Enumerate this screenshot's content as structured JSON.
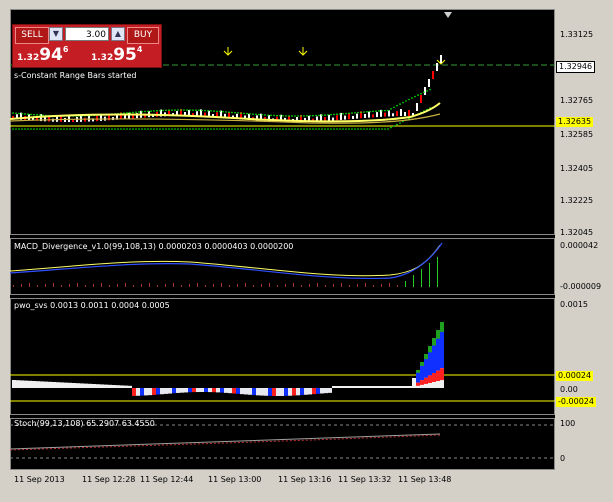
{
  "trade_panel": {
    "sell_label": "SELL",
    "buy_label": "BUY",
    "lot": "3.00",
    "bid": {
      "small": "1.32",
      "big": "94",
      "sup": "6"
    },
    "ask": {
      "small": "1.32",
      "big": "95",
      "sup": "4"
    }
  },
  "main": {
    "status_text": "s-Constant Range Bars started",
    "price_axis": [
      "1.33125",
      "1.32765",
      "1.32585",
      "1.32405",
      "1.32225",
      "1.32045"
    ],
    "current_price": "1.32946",
    "line_price": "1.32635"
  },
  "macd": {
    "title": "MACD_Divergence_v1.0(99,108,13) 0.0000203 0.0000403 0.0000200",
    "axis_top": "0.000042",
    "axis_bottom": "-0.000009"
  },
  "pwo": {
    "title": "pwo_svs 0.0013 0.0011 0.0004 0.0005",
    "axis_top": "0.0015",
    "tag_upper": "0.00024",
    "axis_zero": "0.00",
    "tag_lower": "-0.00024"
  },
  "stoch": {
    "title": "Stoch(99,13,108) 65.2907 63.4550",
    "axis_top": "100",
    "axis_bottom": "0"
  },
  "time_axis": [
    "11 Sep 2013",
    "11 Sep 12:28",
    "11 Sep 12:44",
    "11 Sep 13:00",
    "11 Sep 13:16",
    "11 Sep 13:32",
    "11 Sep 13:48"
  ],
  "colors": {
    "background": "#000000",
    "frame": "#d4d0c8",
    "price_line": "#ffff00",
    "bull": "#ffffff",
    "bear": "#ff0000",
    "dots": "#00ff00"
  }
}
